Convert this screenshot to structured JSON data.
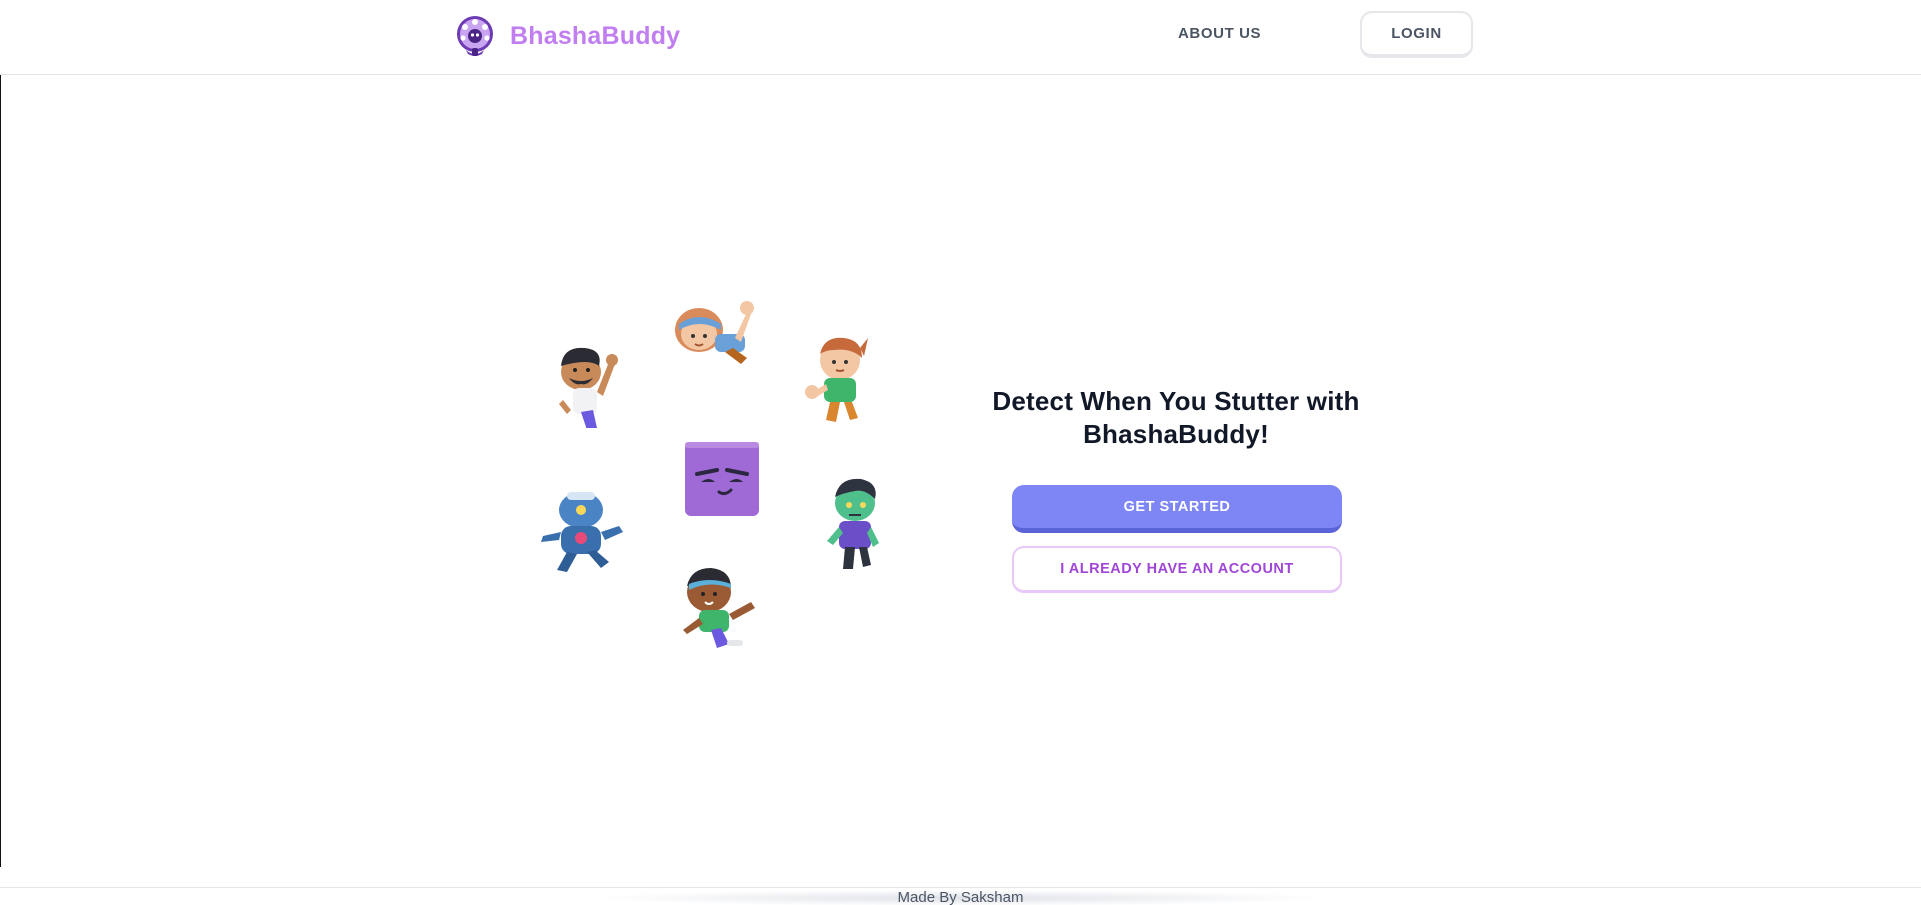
{
  "header": {
    "brand_name": "BhashaBuddy",
    "nav_about": "ABOUT US",
    "login_label": "LOGIN"
  },
  "hero": {
    "headline_line1": "Detect When You Stutter with",
    "headline_line2": "BhashaBuddy!",
    "get_started_label": "GET STARTED",
    "have_account_label": "I ALREADY HAVE AN ACCOUNT"
  },
  "footer": {
    "credit": "Made By Saksham"
  },
  "colors": {
    "brand": "#c17ef0",
    "primary": "#7d86f4",
    "secondary_text": "#a046d6",
    "mascot": "#a06ad6"
  }
}
